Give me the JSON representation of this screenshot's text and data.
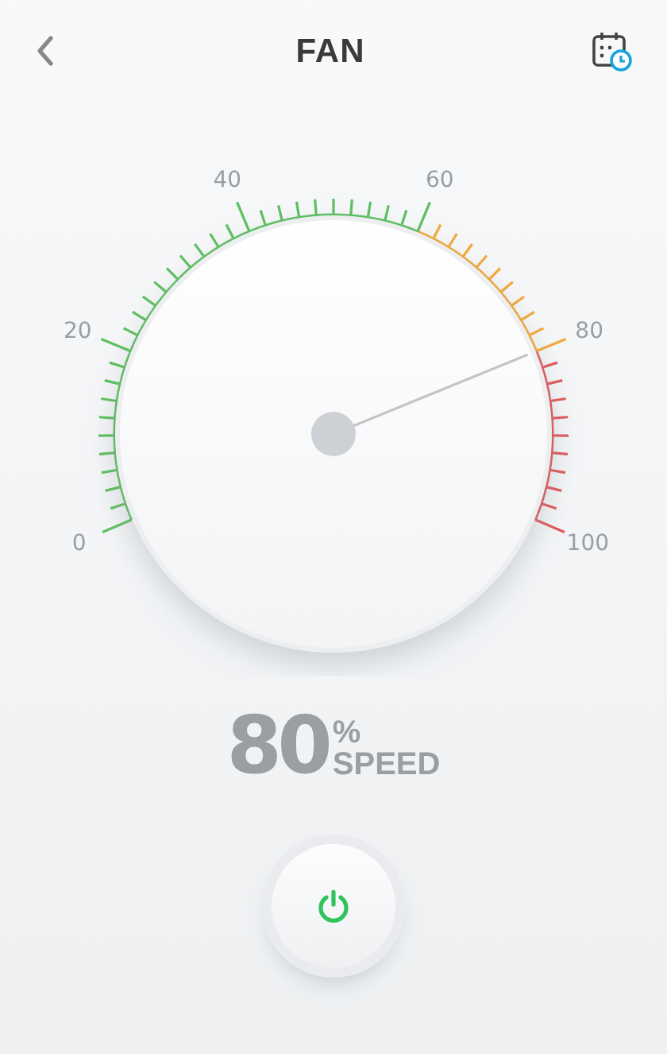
{
  "header": {
    "title": "FAN"
  },
  "gauge": {
    "scale_labels": [
      "0",
      "20",
      "40",
      "60",
      "80",
      "100"
    ]
  },
  "speed": {
    "value": "80",
    "unit": "%",
    "label": "SPEED"
  },
  "power": {
    "on": true
  }
}
